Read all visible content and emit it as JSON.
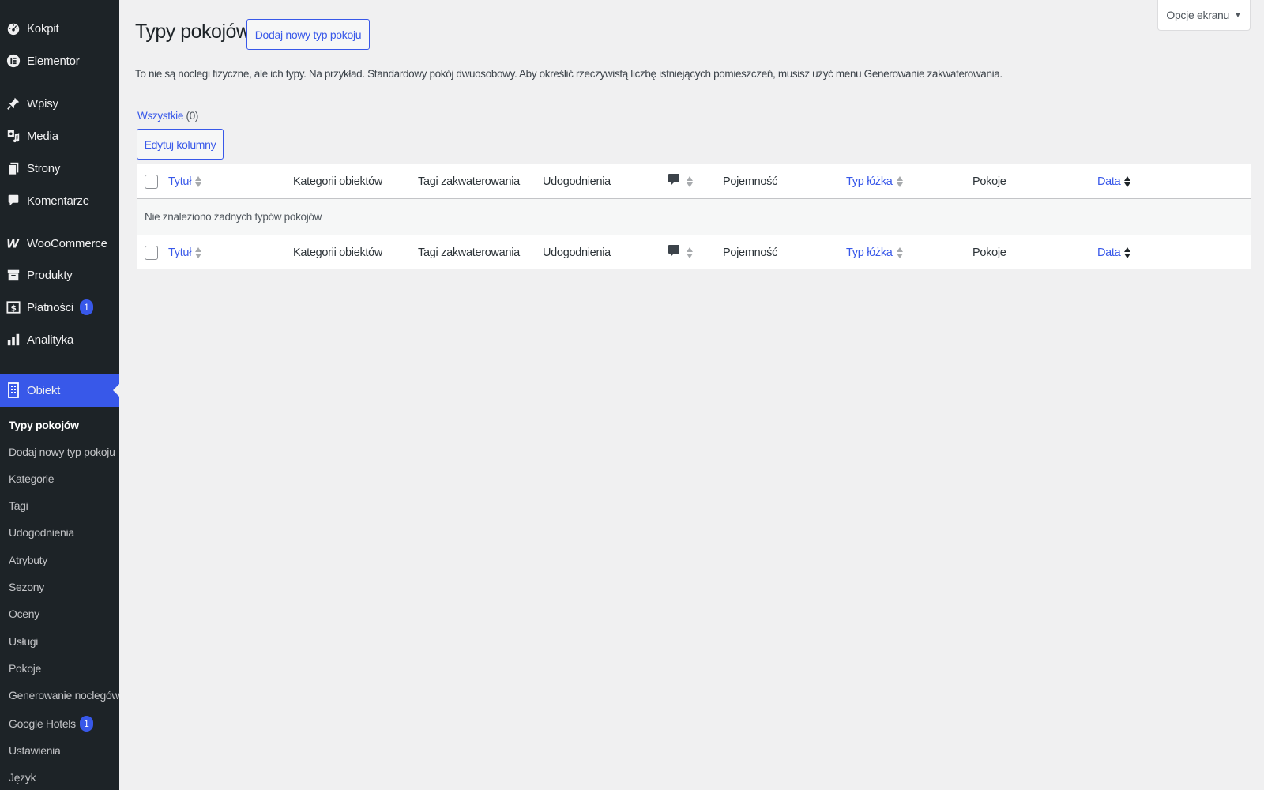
{
  "sidebar": {
    "menu": [
      {
        "label": "Kokpit",
        "icon": "dashboard-icon"
      },
      {
        "label": "Elementor",
        "icon": "elementor-icon"
      },
      {
        "label": "Wpisy",
        "icon": "pin-icon"
      },
      {
        "label": "Media",
        "icon": "media-icon"
      },
      {
        "label": "Strony",
        "icon": "pages-icon"
      },
      {
        "label": "Komentarze",
        "icon": "comments-icon"
      },
      {
        "label": "WooCommerce",
        "icon": "woocommerce-icon"
      },
      {
        "label": "Produkty",
        "icon": "products-icon"
      },
      {
        "label": "Płatności",
        "icon": "payments-icon",
        "badge": "1"
      },
      {
        "label": "Analityka",
        "icon": "analytics-icon"
      },
      {
        "label": "Obiekt",
        "icon": "building-icon",
        "current": true
      }
    ],
    "submenu": [
      {
        "label": "Typy pokojów",
        "active": true
      },
      {
        "label": "Dodaj nowy typ pokoju"
      },
      {
        "label": "Kategorie"
      },
      {
        "label": "Tagi"
      },
      {
        "label": "Udogodnienia"
      },
      {
        "label": "Atrybuty"
      },
      {
        "label": "Sezony"
      },
      {
        "label": "Oceny"
      },
      {
        "label": "Usługi"
      },
      {
        "label": "Pokoje"
      },
      {
        "label": "Generowanie noclegów"
      },
      {
        "label": "Google Hotels",
        "badge": "1"
      },
      {
        "label": "Ustawienia"
      },
      {
        "label": "Język"
      }
    ]
  },
  "header": {
    "screen_options": "Opcje ekranu",
    "title": "Typy pokojów",
    "add_new": "Dodaj nowy typ pokoju"
  },
  "description": "To nie są noclegi fizyczne, ale ich typy. Na przykład. Standardowy pokój dwuosobowy. Aby określić rzeczywistą liczbę istniejących pomieszczeń, musisz użyć menu Generowanie zakwaterowania.",
  "filters": {
    "all_label": "Wszystkie",
    "all_count": "(0)"
  },
  "edit_columns": "Edytuj kolumny",
  "table": {
    "columns": {
      "title": "Tytuł",
      "categories": "Kategorii obiektów",
      "tags": "Tagi zakwaterowania",
      "amenities": "Udogodnienia",
      "capacity": "Pojemność",
      "bed_type": "Typ łóżka",
      "rooms": "Pokoje",
      "date": "Data"
    },
    "empty_message": "Nie znaleziono żadnych typów pokojów"
  }
}
